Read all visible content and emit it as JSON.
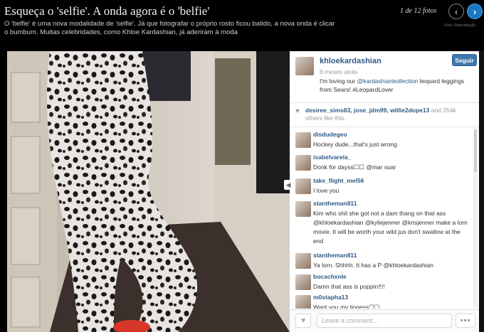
{
  "header": {
    "title": "Esqueça o 'selfie'. A onda agora é o 'belfie'",
    "description": "O 'belfie' é uma nova modalidade de 'selfie'. Já que fotografar o próprio rosto ficou batido, a nova onda é clicar o bumbum. Muitas celebridades, como Khloe Kardashian, já aderiram à moda",
    "counter": "1 de 12 fotos",
    "photo_credit": "Foto: Reprodução",
    "prev_icon": "chevron-left-icon",
    "next_icon": "chevron-right-icon"
  },
  "post": {
    "username": "khloekardashian",
    "time_ago": "6 meses atrás",
    "caption_before": "I'm loving our ",
    "caption_link": "@kardashiankollection",
    "caption_after": " leopard leggings from Sears! #LeopardLover",
    "follow_label": "Seguir",
    "accent_color": "#3f78ac"
  },
  "likes": {
    "users": "desiree_sims83, jose_jdm99, willie2dope13",
    "rest": " and 254k others like this."
  },
  "comments": [
    {
      "user": "disdudegeo",
      "text": "Hockey dude...that's just wrong"
    },
    {
      "user": "isabelvarela_",
      "text": "Donk for dayss☐☐ @mar  suar"
    },
    {
      "user": "take_flight_mel56",
      "text": "I love you"
    },
    {
      "user": "stantheman811",
      "text": "Kim who shit she got not a dam thang on that ass @khloekardashian @kyliejenner @krisjenner make a lorn movie. It will be worth your wild jus don't swallow at the end"
    },
    {
      "user": "stantheman811",
      "text": "Ya lorn. Shhhh. It has a P @khloekardashian"
    },
    {
      "user": "bocachxnle",
      "text": "Damn that ass is poppin!!!!"
    },
    {
      "user": "m0stapha13",
      "text": "Want you my lioness☐☐"
    }
  ],
  "footer": {
    "comment_placeholder": "Leave a comment...",
    "more_label": "•••",
    "like_icon": "heart-icon"
  }
}
